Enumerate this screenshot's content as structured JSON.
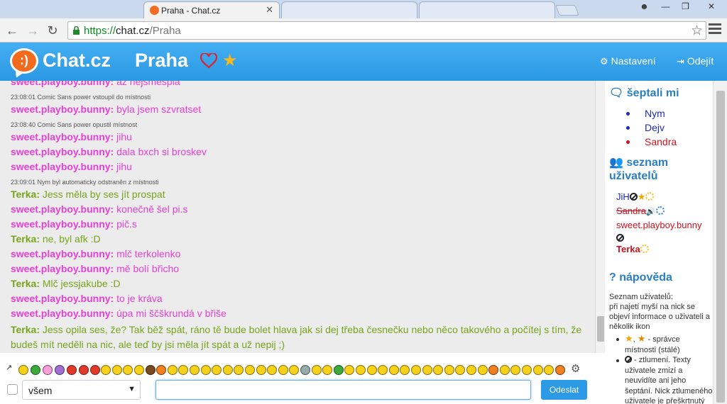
{
  "browser": {
    "tab_title": "Praha - Chat.cz",
    "url_scheme": "https://",
    "url_host": "chat.cz",
    "url_path": "/Praha"
  },
  "header": {
    "brand": "Chat.cz",
    "room": "Praha",
    "settings_label": "Nastavení",
    "logout_label": "Odejít"
  },
  "colors": {
    "accent": "#2b98e3",
    "message_pink": "#e83fd6",
    "message_green": "#76a51b"
  },
  "messages": [
    {
      "type": "msg",
      "nick": "sweet.playboy.bunny:",
      "text": "až nejsmešplá",
      "color": "pink"
    },
    {
      "type": "sys",
      "text": "23:08:01 Comic Sans power vstoupil do místnosti"
    },
    {
      "type": "msg",
      "nick": "sweet.playboy.bunny:",
      "text": "byla jsem szvratset",
      "color": "pink"
    },
    {
      "type": "sys",
      "text": "23:08:40 Comic Sans power opustil místnost"
    },
    {
      "type": "msg",
      "nick": "sweet.playboy.bunny:",
      "text": "jihu",
      "color": "pink"
    },
    {
      "type": "msg",
      "nick": "sweet.playboy.bunny:",
      "text": "dala bxch si broskev",
      "color": "pink"
    },
    {
      "type": "msg",
      "nick": "sweet.playboy.bunny:",
      "text": "jihu",
      "color": "pink"
    },
    {
      "type": "sys",
      "text": "23:09:01 Nym byl automaticky odstraněn z místnosti"
    },
    {
      "type": "msg",
      "nick": "Terka:",
      "text": "Jess měla by ses jít prospat",
      "color": "green"
    },
    {
      "type": "msg",
      "nick": "sweet.playboy.bunny:",
      "text": "konečně šel pi.s",
      "color": "pink"
    },
    {
      "type": "msg",
      "nick": "sweet.playboy.bunny:",
      "text": "pič.s",
      "color": "pink"
    },
    {
      "type": "msg",
      "nick": "Terka:",
      "text": "ne, byl afk :D",
      "color": "green"
    },
    {
      "type": "msg",
      "nick": "sweet.playboy.bunny:",
      "text": "mlč terkolenko",
      "color": "pink"
    },
    {
      "type": "msg",
      "nick": "sweet.playboy.bunny:",
      "text": "mě bolí břicho",
      "color": "pink"
    },
    {
      "type": "msg",
      "nick": "Terka:",
      "text": "Mlč jessjakube :D",
      "color": "green"
    },
    {
      "type": "msg",
      "nick": "sweet.playboy.bunny:",
      "text": "to je kráva",
      "color": "pink"
    },
    {
      "type": "msg",
      "nick": "sweet.playboy.bunny:",
      "text": "úpa mi ščškrundá v břiše",
      "color": "pink"
    },
    {
      "type": "msg",
      "nick": "Terka:",
      "text": "Jess opila ses, že? Tak běž spát, ráno tě bude bolet hlava jak si dej třeba česnečku nebo něco takového a počítej s tím, že budeš mít neděli na nic, ale teď by jsi měla jít spát a už nepij ;)",
      "color": "green"
    }
  ],
  "sidebar": {
    "whispers_title": "šeptali mi",
    "whispers": [
      {
        "name": "Nym",
        "color": "#1a2bb8"
      },
      {
        "name": "Dejv",
        "color": "#1a2bb8"
      },
      {
        "name": "Sandra",
        "color": "#d0101e"
      }
    ],
    "users_title_1": "seznam",
    "users_title_2": "uživatelů",
    "users": [
      {
        "name": "JiH",
        "color": "#1a2bb8"
      },
      {
        "name": "Sandra",
        "color": "#d0101e"
      },
      {
        "name": "sweet.playboy.bunny",
        "color": "#d0101e"
      },
      {
        "name": "Terka",
        "color": "#d0101e"
      }
    ],
    "help_title": "nápověda",
    "help_intro_1": "Seznam uživatelů:",
    "help_intro_2": "při najetí myší na nick se objeví informace o uživateli a několik ikon",
    "help_items": [
      " - správce místnosti (stálé)",
      " - ztlumení. Texty uživatele zmizí a neuvidíte ani jeho šeptání. Nick ztlumeného uživatele je přeškrtnutý"
    ]
  },
  "composer": {
    "recipient_value": "všem",
    "send_label": "Odeslat",
    "message_value": ""
  },
  "emoticons": [
    "arrow",
    "smile",
    "creeper",
    "pink",
    "pink2",
    "devil",
    "devil2",
    "evil",
    "smile",
    "laugh",
    "grin",
    "smile",
    "poop",
    "sun",
    "wink",
    "smile",
    "surprise",
    "cool",
    "grin",
    "smile",
    "smile",
    "smile",
    "smile",
    "laugh",
    "cool",
    "smile",
    "alien",
    "smile",
    "smile",
    "sick",
    "smile",
    "smile",
    "smile",
    "smile",
    "smile",
    "smile",
    "smile",
    "cool",
    "smile",
    "smile",
    "cool",
    "smile",
    "smile",
    "dog",
    "smile",
    "smile",
    "smile",
    "smile",
    "smile",
    "orange"
  ]
}
